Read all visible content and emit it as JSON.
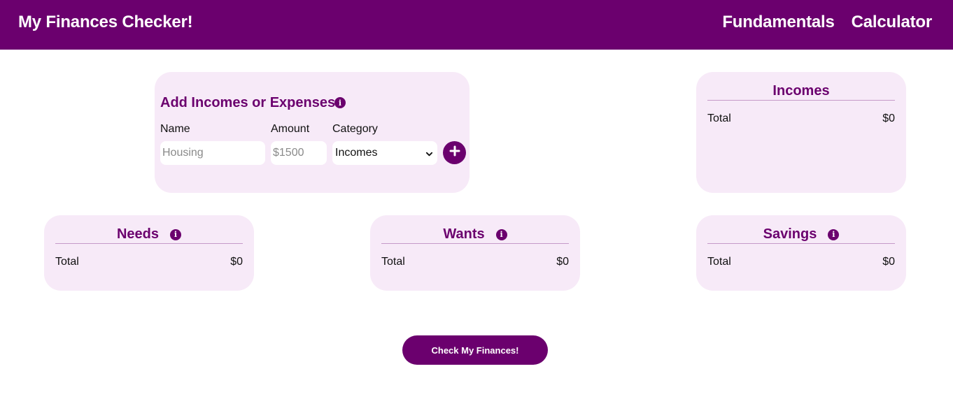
{
  "header": {
    "title": "My Finances Checker!",
    "nav": [
      "Fundamentals",
      "Calculator"
    ]
  },
  "add_form": {
    "title": "Add Incomes or Expenses",
    "name_label": "Name",
    "amount_label": "Amount",
    "category_label": "Category",
    "name_placeholder": "Housing",
    "amount_placeholder": "$1500",
    "category_selected": "Incomes",
    "add_icon": "plus-icon"
  },
  "summaries": {
    "incomes": {
      "title": "Incomes",
      "total_label": "Total",
      "total_value": "$0"
    },
    "needs": {
      "title": "Needs",
      "total_label": "Total",
      "total_value": "$0"
    },
    "wants": {
      "title": "Wants",
      "total_label": "Total",
      "total_value": "$0"
    },
    "savings": {
      "title": "Savings",
      "total_label": "Total",
      "total_value": "$0"
    }
  },
  "check_button": "Check My Finances!",
  "colors": {
    "brand": "#6b006e",
    "card_bg": "#f7eaf8",
    "divider": "#c59ac8"
  },
  "icons": {
    "info": "info-icon",
    "dropdown": "chevron-down-icon"
  }
}
